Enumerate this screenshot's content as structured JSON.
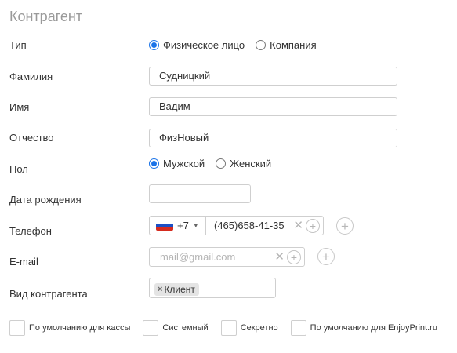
{
  "title": "Контрагент",
  "type_field": {
    "label": "Тип",
    "options": [
      {
        "label": "Физическое лицо",
        "selected": true
      },
      {
        "label": "Компания",
        "selected": false
      }
    ]
  },
  "last_name": {
    "label": "Фамилия",
    "value": "Судницкий"
  },
  "first_name": {
    "label": "Имя",
    "value": "Вадим"
  },
  "middle_name": {
    "label": "Отчество",
    "value": "ФизНовый"
  },
  "gender": {
    "label": "Пол",
    "options": [
      {
        "label": "Мужской",
        "selected": true
      },
      {
        "label": "Женский",
        "selected": false
      }
    ]
  },
  "birth_date": {
    "label": "Дата рождения",
    "value": ""
  },
  "phone": {
    "label": "Телефон",
    "country_code": "+7",
    "country_flag": "russia-flag-icon",
    "value": "(465)658-41-35"
  },
  "email": {
    "label": "E-mail",
    "placeholder": "mail@gmail.com",
    "value": ""
  },
  "counterparty_type": {
    "label": "Вид контрагента",
    "tags": [
      "Клиент"
    ]
  },
  "checkboxes": [
    {
      "label": "По умолчанию для кассы",
      "checked": false
    },
    {
      "label": "Системный",
      "checked": false
    },
    {
      "label": "Секретно",
      "checked": false
    },
    {
      "label": "По умолчанию для EnjoyPrint.ru",
      "checked": false
    }
  ],
  "colors": {
    "accent": "#1a73e8",
    "border": "#cfcfcf",
    "title": "#9a9a9a"
  }
}
